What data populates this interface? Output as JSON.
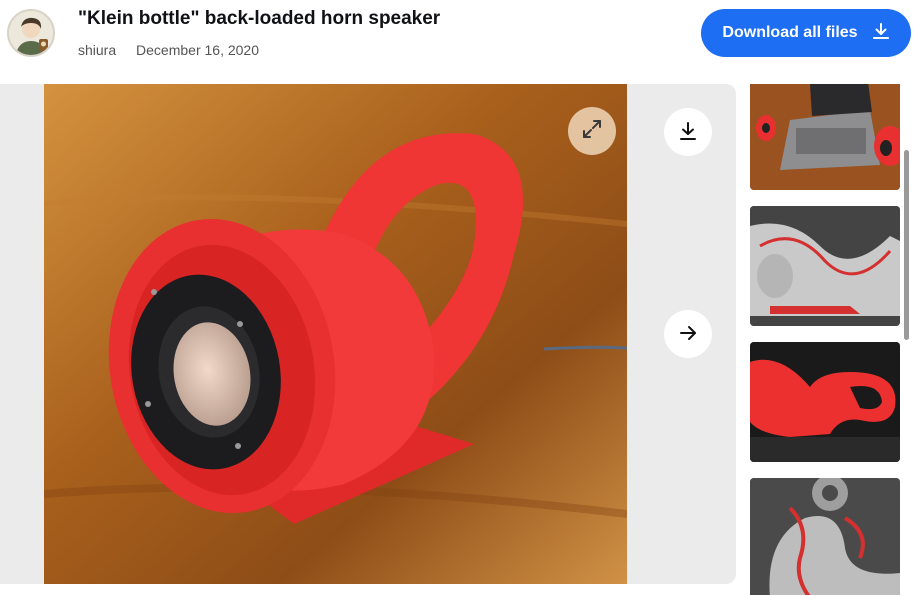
{
  "header": {
    "title": "\"Klein bottle\" back-loaded horn speaker",
    "author": "shiura",
    "date": "December 16, 2020",
    "download_all_label": "Download all files"
  },
  "viewer": {
    "icons": {
      "expand": "expand-icon",
      "download": "download-icon",
      "next": "arrow-right-icon"
    }
  },
  "colors": {
    "accent": "#1d6ef2",
    "speaker_red": "#ea3333",
    "viewer_bg": "#ebebeb"
  }
}
